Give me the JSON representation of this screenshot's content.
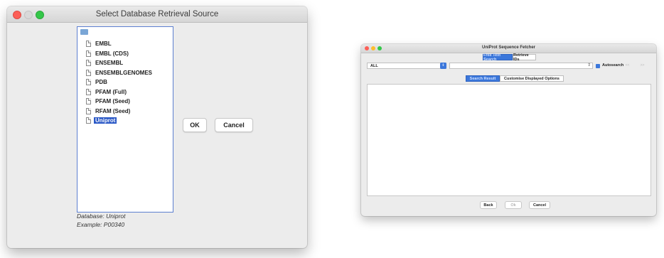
{
  "retrieval_dialog": {
    "title": "Select Database Retrieval Source",
    "sources": [
      "EMBL",
      "EMBL (CDS)",
      "ENSEMBL",
      "ENSEMBLGENOMES",
      "PDB",
      "PFAM (Full)",
      "PFAM (Seed)",
      "RFAM (Seed)",
      "Uniprot"
    ],
    "selected_source": "Uniprot",
    "ok_label": "OK",
    "cancel_label": "Cancel",
    "database_text": "Database: Uniprot",
    "example_text": "Example: P00340"
  },
  "fetcher_window": {
    "title": "UniProt Sequence Fetcher",
    "tabs": [
      "Free Text Search",
      "Retrieve IDs"
    ],
    "active_tab": "Free Text Search",
    "field_select_value": "ALL",
    "query_value": "",
    "autosearch_label": "Autosearch",
    "autosearch_checked": true,
    "prev_label": "<<",
    "next_label": ">>",
    "subtabs": [
      "Search Result",
      "Customise Displayed Options"
    ],
    "active_subtab": "Search Result",
    "back_label": "Back",
    "ok_label": "Ok",
    "cancel_label": "Cancel",
    "ok_enabled": false
  },
  "colors": {
    "accent": "#3b77db",
    "selection": "#2a58c6",
    "window_bg": "#ececec"
  }
}
